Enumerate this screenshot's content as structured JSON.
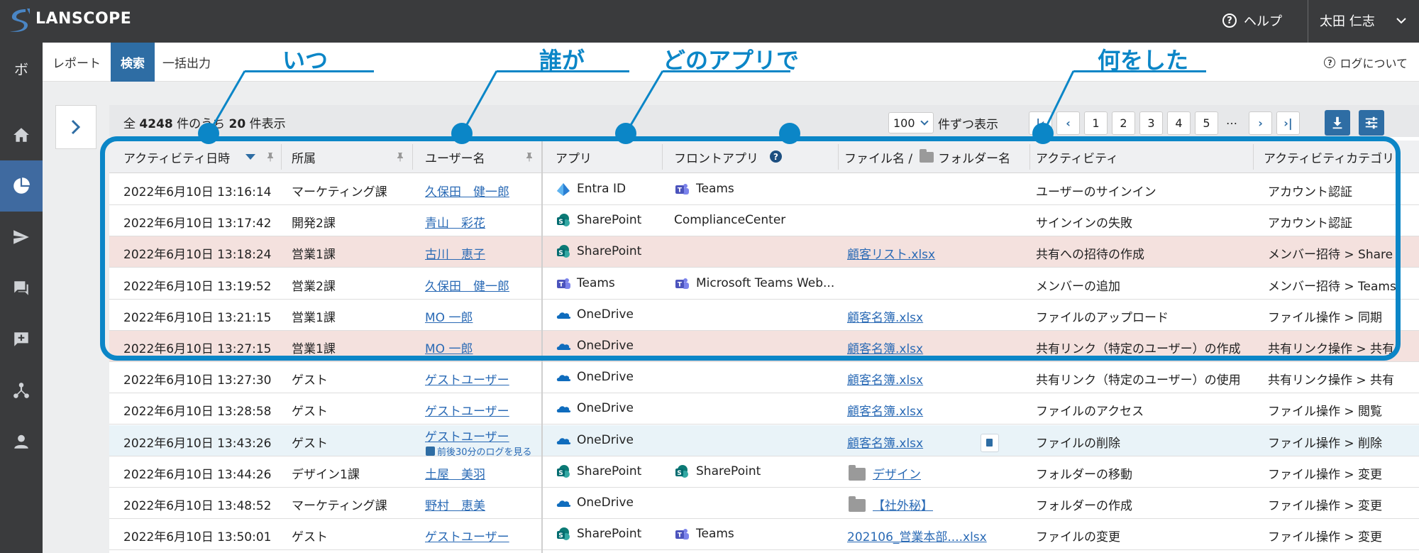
{
  "header": {
    "logo": "LANSCOPE",
    "help_label": "ヘルプ",
    "user_name": "太田 仁志"
  },
  "sidebar": {
    "top_label": "ボ",
    "items": [
      "home-icon",
      "pie-chart-icon",
      "send-icon",
      "chat-icon",
      "comment-add-icon",
      "network-icon",
      "person-icon"
    ],
    "active_index": 1
  },
  "tabs": [
    {
      "label": "レポート",
      "active": false
    },
    {
      "label": "検索",
      "active": true
    },
    {
      "label": "一括出力",
      "active": false
    }
  ],
  "about_label": "ログについて",
  "summary": {
    "prefix": "全",
    "total": "4248",
    "middle": "件のうち",
    "shown": "20",
    "suffix": "件表示"
  },
  "pagination": {
    "per_page": "100",
    "per_page_label": "件ずつ表示",
    "pages": [
      "1",
      "2",
      "3",
      "4",
      "5"
    ],
    "ellipsis": "…"
  },
  "columns": [
    "アクティビティ日時",
    "所属",
    "ユーザー名",
    "アプリ",
    "フロントアプリ",
    "ファイル名 /",
    "フォルダー名",
    "アクティビティ",
    "アクティビティカテゴリ"
  ],
  "rows": [
    {
      "datetime": "2022年6月10日 13:16:14",
      "dept": "マーケティング課",
      "user": "久保田　健一郎",
      "app": "Entra ID",
      "app_icon": "entra",
      "front_app": "Teams",
      "front_icon": "teams",
      "file": "",
      "folder_icon": false,
      "activity": "ユーザーのサインイン",
      "category": "アカウント認証",
      "style": "white"
    },
    {
      "datetime": "2022年6月10日 13:17:42",
      "dept": "開発2課",
      "user": "青山　彩花",
      "app": "SharePoint",
      "app_icon": "sharepoint",
      "front_app": "ComplianceCenter",
      "front_icon": "",
      "file": "",
      "folder_icon": false,
      "activity": "サインインの失敗",
      "category": "アカウント認証",
      "style": "white"
    },
    {
      "datetime": "2022年6月10日 13:18:24",
      "dept": "営業1課",
      "user": "古川　恵子",
      "app": "SharePoint",
      "app_icon": "sharepoint",
      "front_app": "",
      "front_icon": "",
      "file": "顧客リスト.xlsx",
      "folder_icon": false,
      "activity": "共有への招待の作成",
      "category": "メンバー招待 > Share",
      "style": "pink"
    },
    {
      "datetime": "2022年6月10日 13:19:52",
      "dept": "営業2課",
      "user": "久保田　健一郎",
      "app": "Teams",
      "app_icon": "teams",
      "front_app": "Microsoft Teams Web...",
      "front_icon": "teams",
      "file": "",
      "folder_icon": false,
      "activity": "メンバーの追加",
      "category": "メンバー招待 > Teams",
      "style": "white"
    },
    {
      "datetime": "2022年6月10日 13:21:15",
      "dept": "営業1課",
      "user": "MO 一郎",
      "app": "OneDrive",
      "app_icon": "onedrive",
      "front_app": "",
      "front_icon": "",
      "file": "顧客名簿.xlsx",
      "folder_icon": false,
      "activity": "ファイルのアップロード",
      "category": "ファイル操作 > 同期",
      "style": "white"
    },
    {
      "datetime": "2022年6月10日 13:27:15",
      "dept": "営業1課",
      "user": "MO 一郎",
      "app": "OneDrive",
      "app_icon": "onedrive",
      "front_app": "",
      "front_icon": "",
      "file": "顧客名簿.xlsx",
      "folder_icon": false,
      "activity": "共有リンク（特定のユーザー）の作成",
      "category": "共有リンク操作 > 共有",
      "style": "pink"
    },
    {
      "datetime": "2022年6月10日 13:27:30",
      "dept": "ゲスト",
      "user": "ゲストユーザー",
      "app": "OneDrive",
      "app_icon": "onedrive",
      "front_app": "",
      "front_icon": "",
      "file": "顧客名簿.xlsx",
      "folder_icon": false,
      "activity": "共有リンク（特定のユーザー）の使用",
      "category": "共有リンク操作 > 共有",
      "style": "white"
    },
    {
      "datetime": "2022年6月10日 13:28:58",
      "dept": "ゲスト",
      "user": "ゲストユーザー",
      "app": "OneDrive",
      "app_icon": "onedrive",
      "front_app": "",
      "front_icon": "",
      "file": "顧客名簿.xlsx",
      "folder_icon": false,
      "activity": "ファイルのアクセス",
      "category": "ファイル操作 > 閲覧",
      "style": "white"
    },
    {
      "datetime": "2022年6月10日 13:43:26",
      "dept": "ゲスト",
      "user": "ゲストユーザー",
      "app": "OneDrive",
      "app_icon": "onedrive",
      "front_app": "",
      "front_icon": "",
      "file": "顧客名簿.xlsx",
      "folder_icon": false,
      "activity": "ファイルの削除",
      "category": "ファイル操作 > 削除",
      "style": "blue",
      "sub_link": "前後30分のログを見る"
    },
    {
      "datetime": "2022年6月10日 13:44:26",
      "dept": "デザイン1課",
      "user": "土屋　美羽",
      "app": "SharePoint",
      "app_icon": "sharepoint",
      "front_app": "SharePoint",
      "front_icon": "sharepoint",
      "file": "デザイン",
      "folder_icon": true,
      "activity": "フォルダーの移動",
      "category": "ファイル操作 > 変更",
      "style": "white"
    },
    {
      "datetime": "2022年6月10日 13:48:52",
      "dept": "マーケティング課",
      "user": "野村　恵美",
      "app": "OneDrive",
      "app_icon": "onedrive",
      "front_app": "",
      "front_icon": "",
      "file": "【社外秘】",
      "folder_icon": true,
      "activity": "フォルダーの作成",
      "category": "ファイル操作 > 変更",
      "style": "white"
    },
    {
      "datetime": "2022年6月10日 13:50:01",
      "dept": "ゲスト",
      "user": "ゲストユーザー",
      "app": "SharePoint",
      "app_icon": "sharepoint",
      "front_app": "Teams",
      "front_icon": "teams",
      "file": "202106_営業本部....xlsx",
      "folder_icon": false,
      "activity": "ファイルの変更",
      "category": "ファイル操作 > 変更",
      "style": "white"
    }
  ],
  "annotations": {
    "when": "いつ",
    "who": "誰が",
    "which_app": "どのアプリで",
    "what": "何をした"
  },
  "colors": {
    "accent": "#2e6da4",
    "annotation": "#0b86c7",
    "header_bg": "#3a3b3d",
    "pink_row": "#f4e1de",
    "blue_row": "#e9f3f8"
  }
}
